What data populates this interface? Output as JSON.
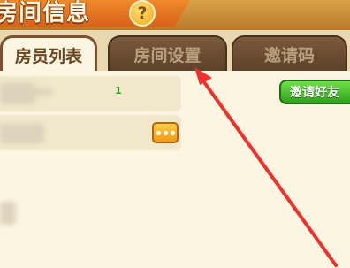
{
  "header": {
    "title": "房间信息",
    "help_icon": "?"
  },
  "tabs": [
    {
      "label": "房员列表",
      "active": true
    },
    {
      "label": "房间设置",
      "active": false
    },
    {
      "label": "邀请码",
      "active": false
    }
  ],
  "members": {
    "count": "1",
    "invite_label": "邀请好友"
  },
  "colors": {
    "accent": "#f08a2a",
    "invite": "#2ea31a",
    "arrow": "#f0302a"
  }
}
